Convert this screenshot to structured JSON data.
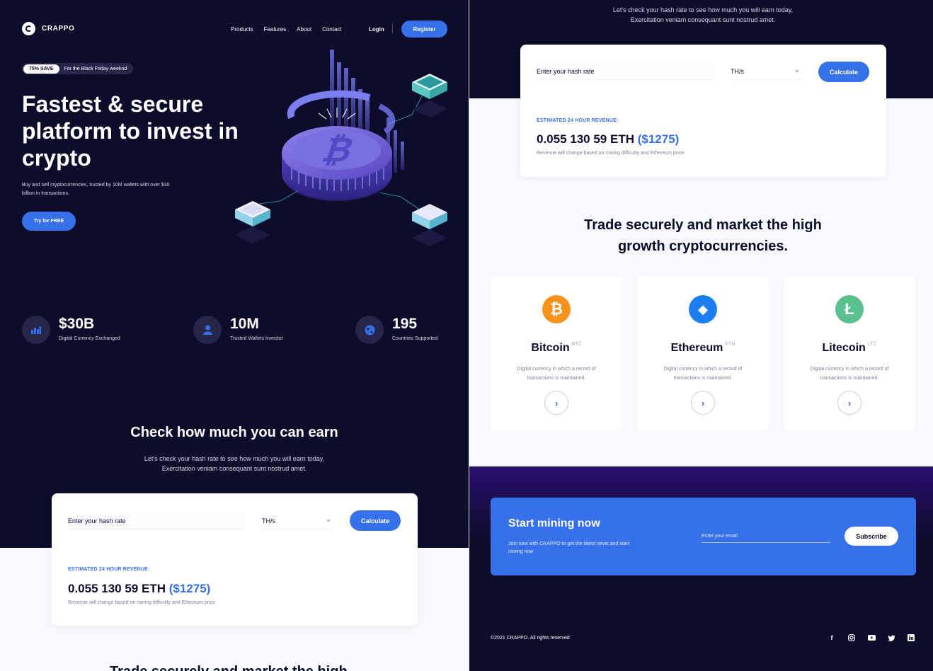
{
  "brand": {
    "name": "CRAPPO"
  },
  "nav": {
    "items": [
      "Products",
      "Features",
      "About",
      "Contact"
    ],
    "login": "Login",
    "register": "Register"
  },
  "hero": {
    "badge": "75% SAVE",
    "promo": "For the Black Friday weeknd",
    "title": "Fastest & secure platform to invest in crypto",
    "subtitle": "Buy and sell cryptocurrencies, trusted by 10M wallets with over $30 billion in transactions.",
    "cta": "Try for FREE"
  },
  "stats": [
    {
      "value": "$30B",
      "label": "Digital Currency Exchanged",
      "icon": "bar-chart-icon"
    },
    {
      "value": "10M",
      "label": "Trusted Wallets Investor",
      "icon": "user-icon"
    },
    {
      "value": "195",
      "label": "Countries Supported",
      "icon": "globe-icon"
    }
  ],
  "earn": {
    "title": "Check how much you can earn",
    "subtitle_line1": "Let's check your hash rate to see how much you will earn today,",
    "subtitle_line2": "Exercitation veniam consequant sunt nostrud amet.",
    "input_placeholder": "Enter your hash rate",
    "unit": "TH/s",
    "button": "Calculate",
    "estimate_label": "ESTIMATED 24 HOUR REVENUE:",
    "estimate_eth": "0.055 130 59 ETH",
    "estimate_usd": "($1275)",
    "note": "Revenue will change based on mining difficulty and Ethereum price."
  },
  "trade": {
    "title_line1": "Trade securely and market the high",
    "title_line2": "growth cryptocurrencies.",
    "coins": [
      {
        "name": "Bitcoin",
        "ticker": "BTC",
        "desc": "Digital currency in which a record of transactions is maintained.",
        "color": "#f7931a",
        "symbol": "₿"
      },
      {
        "name": "Ethereum",
        "ticker": "ETH",
        "desc": "Digital currency in which a record of transactions is maintained.",
        "color": "#1c7ef0",
        "symbol": "◆"
      },
      {
        "name": "Litecoin",
        "ticker": "LTC",
        "desc": "Digital currency in which a record of transactions is maintained.",
        "color": "#5ac18e",
        "symbol": "Ł"
      }
    ]
  },
  "mining": {
    "title": "Start mining now",
    "subtitle": "Join now with CRAPPO to get the latest news and start mining now",
    "email_placeholder": "Enter your email",
    "button": "Subscribe"
  },
  "footer": {
    "copyright": "©2021 CRAPPO. All rights reserved",
    "socials": [
      "facebook-icon",
      "instagram-icon",
      "youtube-icon",
      "twitter-icon",
      "linkedin-icon"
    ]
  },
  "colors": {
    "dark": "#0d0c2b",
    "accent": "#3671e9",
    "light": "#f7f8fc"
  }
}
